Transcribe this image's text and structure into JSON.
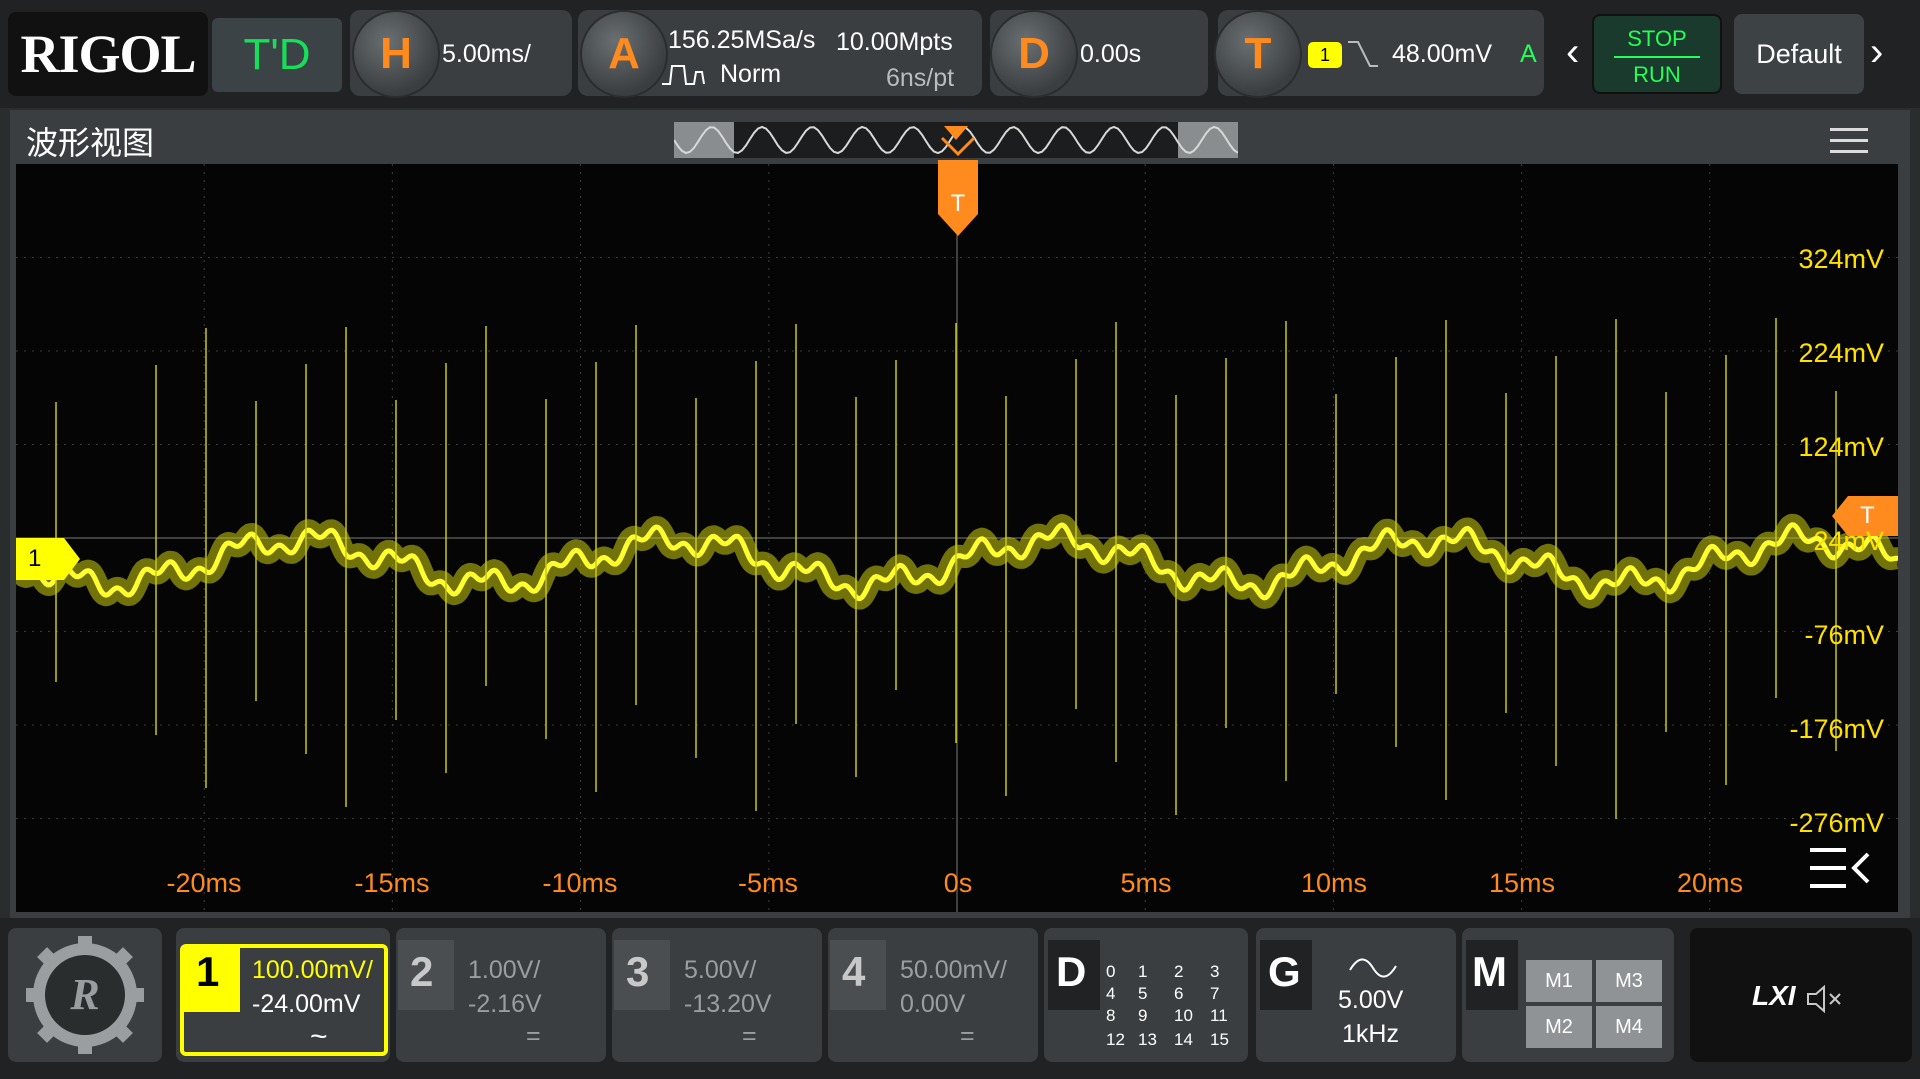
{
  "header": {
    "logo": "RIGOL",
    "mode_tag": "T'D",
    "horizontal": {
      "knob": "H",
      "scale": "5.00ms/"
    },
    "acquire": {
      "knob": "A",
      "sample_rate": "156.25MSa/s",
      "memory_depth": "10.00Mpts",
      "mode": "Norm",
      "time_per_point": "6ns/pt"
    },
    "delay": {
      "knob": "D",
      "value": "0.00s"
    },
    "trigger": {
      "knob": "T",
      "source": "1",
      "level": "48.00mV",
      "sweep": "A"
    },
    "stop_label": "STOP",
    "run_label": "RUN",
    "default_label": "Default"
  },
  "waveform_view": {
    "title": "波形视图",
    "trigger_marker": "T",
    "channel_marker": "1",
    "trigger_level_marker": "T",
    "y_labels": [
      "324mV",
      "224mV",
      "124mV",
      "24mV",
      "-76mV",
      "-176mV",
      "-276mV"
    ],
    "x_labels": [
      "-20ms",
      "-15ms",
      "-10ms",
      "-5ms",
      "0s",
      "5ms",
      "10ms",
      "15ms",
      "20ms"
    ]
  },
  "channels": [
    {
      "num": "1",
      "scale": "100.00mV/",
      "offset": "-24.00mV",
      "coupling": "~",
      "active": true,
      "color": "#ffff00"
    },
    {
      "num": "2",
      "scale": "1.00V/",
      "offset": "-2.16V",
      "coupling": "=",
      "active": false
    },
    {
      "num": "3",
      "scale": "5.00V/",
      "offset": "-13.20V",
      "coupling": "=",
      "active": false
    },
    {
      "num": "4",
      "scale": "50.00mV/",
      "offset": "0.00V",
      "coupling": "=",
      "active": false
    }
  ],
  "digital": {
    "label": "D",
    "channels": [
      "0",
      "1",
      "2",
      "3",
      "4",
      "5",
      "6",
      "7",
      "8",
      "9",
      "10",
      "11",
      "12",
      "13",
      "14",
      "15"
    ]
  },
  "generator": {
    "label": "G",
    "amplitude": "5.00V",
    "frequency": "1kHz"
  },
  "math": {
    "label": "M",
    "items": [
      "M1",
      "M3",
      "M2",
      "M4"
    ]
  },
  "status": {
    "lxi": "LXI"
  },
  "colors": {
    "ch1": "#ffff00",
    "accent": "#ff8a1e",
    "run": "#22ff55"
  }
}
